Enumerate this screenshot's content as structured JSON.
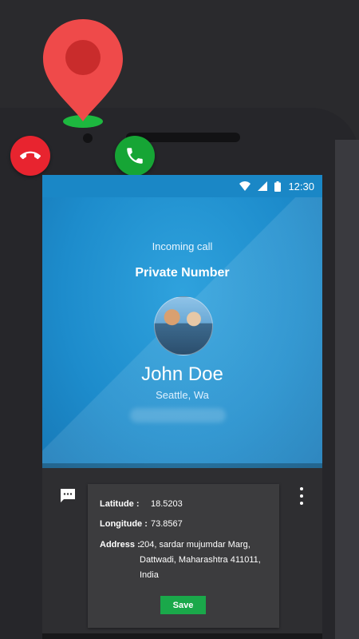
{
  "status_bar": {
    "time": "12:30",
    "icons": [
      "wifi-icon",
      "signal-icon",
      "battery-icon"
    ]
  },
  "call": {
    "header": "Incoming call",
    "number_type": "Private Number",
    "caller_name": "John Doe",
    "caller_location": "Seattle, Wa"
  },
  "details": {
    "latitude_label": "Latitude :",
    "latitude_value": "18.5203",
    "longitude_label": "Longitude :",
    "longitude_value": "73.8567",
    "address_label": "Address :",
    "address_value": "204, sardar mujumdar Marg, Dattwadi, Maharashtra 411011, India",
    "save_label": "Save"
  },
  "colors": {
    "pin": "#ef4a4a",
    "pin_base": "#1db83f",
    "decline": "#e8242f",
    "accept": "#16a535",
    "screen_blue": "#2196d6",
    "save_green": "#1aa84a"
  }
}
